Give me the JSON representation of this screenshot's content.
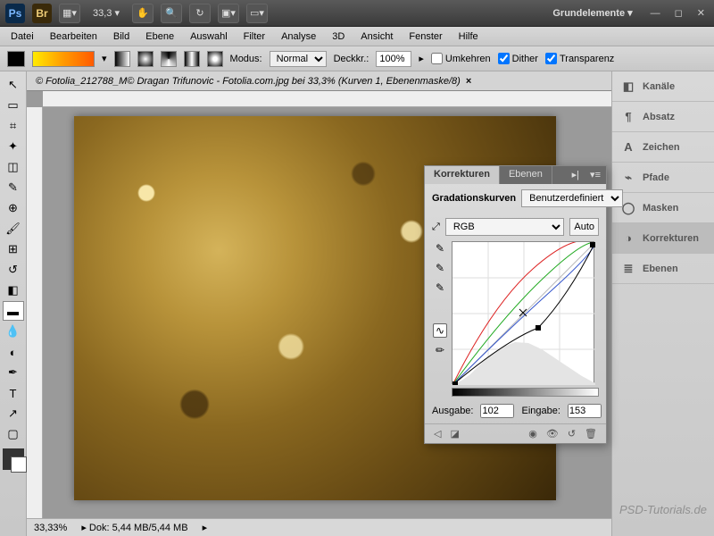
{
  "topbar": {
    "ps": "Ps",
    "br": "Br",
    "zoom": "33,3",
    "workspace": "Grundelemente ▾"
  },
  "menu": {
    "datei": "Datei",
    "bearbeiten": "Bearbeiten",
    "bild": "Bild",
    "ebene": "Ebene",
    "auswahl": "Auswahl",
    "filter": "Filter",
    "analyse": "Analyse",
    "dd": "3D",
    "ansicht": "Ansicht",
    "fenster": "Fenster",
    "hilfe": "Hilfe"
  },
  "options": {
    "modus_label": "Modus:",
    "modus_value": "Normal",
    "deckkr_label": "Deckkr.:",
    "deckkr_value": "100%",
    "umkehren": "Umkehren",
    "dither": "Dither",
    "transparenz": "Transparenz"
  },
  "doc": {
    "title": "© Fotolia_212788_M© Dragan Trifunovic - Fotolia.com.jpg bei 33,3% (Kurven 1, Ebenenmaske/8)",
    "close": "×"
  },
  "status": {
    "zoom": "33,33%",
    "doc": "Dok: 5,44 MB/5,44 MB"
  },
  "panels": {
    "kanaele": "Kanäle",
    "absatz": "Absatz",
    "zeichen": "Zeichen",
    "pfade": "Pfade",
    "masken": "Masken",
    "korrekturen": "Korrekturen",
    "ebenen": "Ebenen"
  },
  "curves": {
    "tab1": "Korrekturen",
    "tab2": "Ebenen",
    "title": "Gradationskurven",
    "preset": "Benutzerdefiniert",
    "channel": "RGB",
    "auto": "Auto",
    "ausgabe_label": "Ausgabe:",
    "ausgabe_value": "102",
    "eingabe_label": "Eingabe:",
    "eingabe_value": "153"
  },
  "watermark": "PSD-Tutorials.de"
}
